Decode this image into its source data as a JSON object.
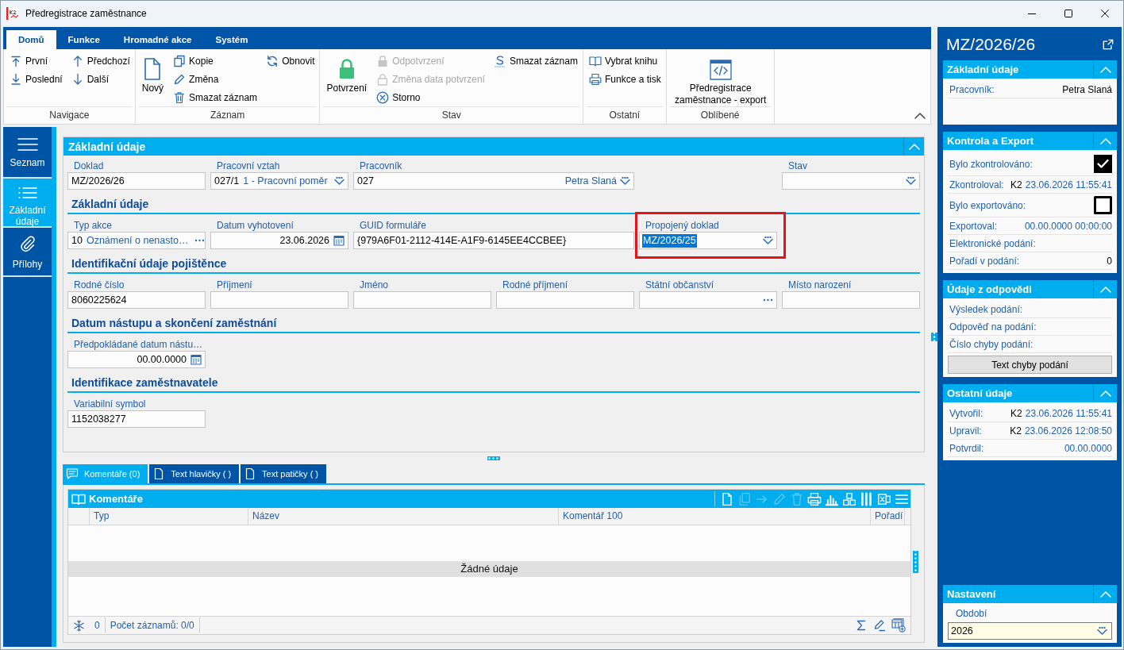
{
  "window": {
    "title": "Předregistrace zaměstnance"
  },
  "ribbon": {
    "tabs": [
      {
        "label": "Domů",
        "selected": true
      },
      {
        "label": "Funkce",
        "selected": false
      },
      {
        "label": "Hromadné akce",
        "selected": false
      },
      {
        "label": "Systém",
        "selected": false
      }
    ],
    "groups": [
      {
        "label": "Navigace",
        "columns": [
          [
            {
              "kind": "small",
              "label": "První",
              "disabled": false
            },
            {
              "kind": "small",
              "label": "Poslední",
              "disabled": false
            }
          ],
          [
            {
              "kind": "small",
              "label": "Předchozí",
              "disabled": false
            },
            {
              "kind": "small",
              "label": "Další",
              "disabled": false
            }
          ]
        ]
      },
      {
        "label": "Záznam",
        "columns": [
          [
            {
              "kind": "large",
              "label": "Nový",
              "disabled": false
            }
          ],
          [
            {
              "kind": "small",
              "label": "Kopie",
              "disabled": false
            },
            {
              "kind": "small",
              "label": "Změna",
              "disabled": false
            },
            {
              "kind": "small",
              "label": "Smazat záznam",
              "disabled": false
            }
          ],
          [
            {
              "kind": "small",
              "label": "Obnovit",
              "disabled": false
            }
          ]
        ]
      },
      {
        "label": "Stav",
        "columns": [
          [
            {
              "kind": "large",
              "label": "Potvrzení",
              "disabled": false
            }
          ],
          [
            {
              "kind": "small",
              "label": "Odpotvrzení",
              "disabled": true
            },
            {
              "kind": "small",
              "label": "Změna data potvrzení",
              "disabled": true
            },
            {
              "kind": "small",
              "label": "Storno",
              "disabled": false
            }
          ],
          [
            {
              "kind": "small",
              "label": "Smazat záznam",
              "disabled": false
            }
          ]
        ]
      },
      {
        "label": "Ostatní",
        "columns": [
          [
            {
              "kind": "small",
              "label": "Vybrat knihu",
              "disabled": false
            },
            {
              "kind": "small",
              "label": "Funkce a tisk",
              "disabled": false
            }
          ]
        ]
      },
      {
        "label": "Oblíbené",
        "columns": [
          [
            {
              "kind": "large",
              "label": "Předregistrace zaměstnance - export",
              "disabled": false
            }
          ]
        ]
      }
    ]
  },
  "sidebar": {
    "items": [
      {
        "label": "Seznam",
        "selected": false
      },
      {
        "label": "Základní údaje",
        "selected": true
      },
      {
        "label": "Přílohy",
        "selected": false
      }
    ]
  },
  "form": {
    "title": "Základní údaje",
    "fields": [
      {
        "label": "Doklad",
        "kind": "text",
        "value": "MZ/2026/26",
        "text_selected": false,
        "marked": false
      },
      {
        "label": "Pracovní vztah",
        "kind": "dropdown",
        "value": "027/1",
        "detail": "1 - Pracovní poměr",
        "text_selected": false,
        "marked": false
      },
      {
        "label": "Pracovník",
        "kind": "dropdown",
        "value": "027",
        "detail": "Petra Slaná",
        "text_selected": false,
        "marked": false
      },
      {
        "label": "Stav",
        "kind": "dropdown",
        "text_selected": false,
        "marked": false
      }
    ],
    "sections": [
      {
        "heading": "Základní údaje",
        "fields": [
          {
            "label": "Typ akce",
            "kind": "lookup",
            "value": "10",
            "detail": "Oznámení o nenasto…",
            "text_selected": false,
            "marked": false
          },
          {
            "label": "Datum vyhotovení",
            "kind": "date",
            "value": "23.06.2026",
            "text_selected": false,
            "marked": false
          },
          {
            "label": "GUID formuláře",
            "kind": "text",
            "value": "{979A6F01-2112-414E-A1F9-6145EE4CCBEE}",
            "text_selected": false,
            "marked": false
          },
          {
            "label": "Propojený doklad",
            "kind": "dropdown",
            "value": "MZ/2026/25",
            "text_selected": true,
            "marked": true
          }
        ]
      },
      {
        "heading": "Identifikační údaje pojištěnce",
        "fields": [
          {
            "label": "Rodné číslo",
            "kind": "text",
            "value": "8060225624",
            "text_selected": false,
            "marked": false
          },
          {
            "label": "Příjmení",
            "kind": "text",
            "text_selected": false,
            "marked": false
          },
          {
            "label": "Jméno",
            "kind": "text",
            "text_selected": false,
            "marked": false
          },
          {
            "label": "Rodné příjmení",
            "kind": "text",
            "text_selected": false,
            "marked": false
          },
          {
            "label": "Státní občanství",
            "kind": "lookup",
            "text_selected": false,
            "marked": false
          },
          {
            "label": "Místo narození",
            "kind": "text",
            "text_selected": false,
            "marked": false
          }
        ]
      },
      {
        "heading": "Datum nástupu a skončení zaměstnání",
        "fields": [
          {
            "label": "Předpokládané datum nástu…",
            "kind": "date",
            "value": "00.00.0000",
            "text_selected": false,
            "marked": false
          }
        ]
      },
      {
        "heading": "Identifikace zaměstnavatele",
        "fields": [
          {
            "label": "Variabilní symbol",
            "kind": "text",
            "value": "1152038277",
            "text_selected": false,
            "marked": false
          }
        ]
      }
    ]
  },
  "detail_tabs": [
    {
      "label": "Komentáře (0)",
      "selected": true
    },
    {
      "label": "Text hlavičky ( )",
      "selected": false
    },
    {
      "label": "Text patičky ( )",
      "selected": false
    }
  ],
  "comments": {
    "title": "Komentáře",
    "toolbar": [
      {
        "disabled": false
      },
      {
        "disabled": true
      },
      {
        "disabled": true
      },
      {
        "disabled": true
      },
      {
        "disabled": true
      },
      {
        "disabled": false
      },
      {
        "disabled": false
      },
      {
        "disabled": false
      },
      {
        "disabled": false
      },
      {
        "disabled": false
      },
      {
        "disabled": false
      }
    ],
    "columns": [
      "Typ",
      "Název",
      "Komentář 100",
      "Pořadí"
    ],
    "empty_text": "Žádné údaje",
    "footer": {
      "count": "0",
      "records": "Počet záznamů: 0/0"
    }
  },
  "panel": {
    "title": "MZ/2026/26",
    "cards": [
      {
        "title": "Základní údaje",
        "rows": [
          {
            "kind": "value",
            "label": "Pracovník:",
            "value": "Petra Slaná"
          }
        ]
      },
      {
        "title": "Kontrola a Export",
        "rows": [
          {
            "kind": "checkbox",
            "label": "Bylo zkontrolováno:",
            "checked": true
          },
          {
            "kind": "stamp",
            "label": "Zkontroloval:",
            "user": "K2",
            "value": "23.06.2026 11:55:41"
          },
          {
            "kind": "checkbox",
            "label": "Bylo exportováno:",
            "checked": false
          },
          {
            "kind": "stamp",
            "label": "Exportoval:",
            "value": "00.00.0000 00:00:00"
          },
          {
            "kind": "value",
            "label": "Elektronické podání:"
          },
          {
            "kind": "value",
            "label": "Pořadí v podání:",
            "value": "0"
          }
        ]
      },
      {
        "title": "Údaje z odpovědi",
        "rows": [
          {
            "kind": "value",
            "label": "Výsledek podání:"
          },
          {
            "kind": "value",
            "label": "Odpověď na podání:"
          },
          {
            "kind": "value",
            "label": "Číslo chyby podání:"
          },
          {
            "kind": "button",
            "label": "Text chyby podání"
          }
        ]
      },
      {
        "title": "Ostatní údaje",
        "rows": [
          {
            "kind": "stamp",
            "label": "Vytvořil:",
            "user": "K2",
            "value": "23.06.2026 11:55:41"
          },
          {
            "kind": "stamp",
            "label": "Upravil:",
            "user": "K2",
            "value": "23.06.2026 12:08:50"
          },
          {
            "kind": "stamp",
            "label": "Potvrdil:",
            "value": "00.00.0000"
          }
        ]
      }
    ],
    "settings": {
      "title": "Nastavení",
      "label": "Období",
      "value": "2026"
    }
  }
}
